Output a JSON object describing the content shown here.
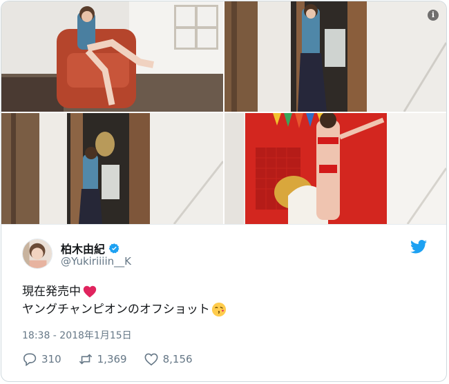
{
  "tweet": {
    "display_name": "柏木由紀",
    "handle": "@Yukiriiiin__K",
    "text_line1": "現在発売中",
    "text_line2": "ヤングチャンピオンのオフショット",
    "timestamp": "18:38 - 2018年1月15日",
    "replies": "310",
    "retweets": "1,369",
    "likes": "8,156"
  },
  "icons": {
    "info": "info-icon",
    "verified": "verified-badge-icon",
    "twitter": "twitter-bird-icon",
    "reply": "reply-icon",
    "retweet": "retweet-icon",
    "like": "heart-icon",
    "emoji1": "red-heart-emoji",
    "emoji2": "kissing-face-emoji"
  },
  "colors": {
    "accent": "#1da1f2",
    "muted_text": "#657786",
    "border": "#cfd9de"
  }
}
